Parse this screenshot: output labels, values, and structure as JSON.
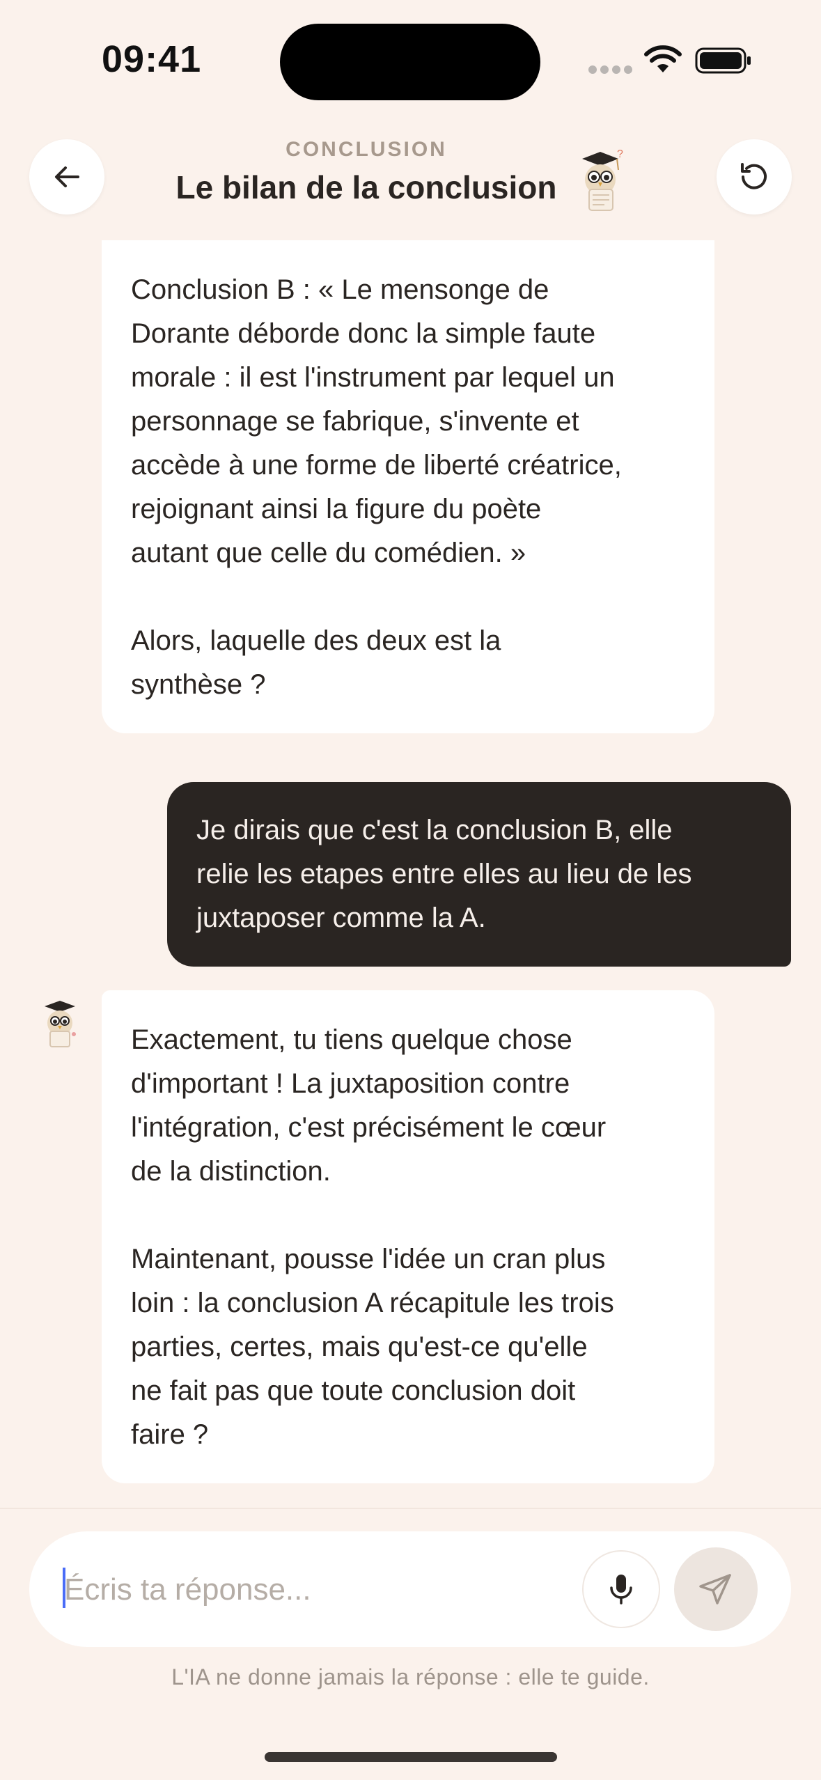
{
  "status_bar": {
    "time": "09:41"
  },
  "header": {
    "eyebrow": "CONCLUSION",
    "title": "Le bilan de la conclusion",
    "back_icon": "arrow-left-icon",
    "reset_icon": "rotate-ccw-icon",
    "mascot_icon": "owl-graduate-icon"
  },
  "messages": [
    {
      "role": "assistant",
      "text": "Conclusion B : « Le mensonge de\nDorante déborde donc la simple faute\nmorale : il est l'instrument par lequel un\npersonnage se fabrique, s'invente et\naccède à une forme de liberté créatrice,\nrejoignant ainsi la figure du poète\nautant que celle du comédien. »\n\nAlors, laquelle des deux est la\nsynthèse ?"
    },
    {
      "role": "user",
      "text": "Je dirais que c'est la conclusion B, elle\nrelie les etapes entre elles au lieu de les\njuxtaposer comme la A."
    },
    {
      "role": "assistant",
      "text": "Exactement, tu tiens quelque chose\nd'important ! La juxtaposition contre\nl'intégration, c'est précisément le cœur\nde la distinction.\n\nMaintenant, pousse l'idée un cran plus\nloin : la conclusion A récapitule les trois\nparties, certes, mais qu'est-ce qu'elle\nne fait pas que toute conclusion doit\nfaire ?"
    }
  ],
  "composer": {
    "placeholder": "Écris ta réponse...",
    "value": "",
    "mic_icon": "microphone-icon",
    "send_icon": "send-icon"
  },
  "footer": {
    "disclaimer": "L'IA ne donne jamais la réponse : elle te guide."
  },
  "colors": {
    "background": "#FBF2EC",
    "user_bubble": "#2A2522",
    "assistant_bubble": "#FFFFFF",
    "muted_text": "#A7998D"
  }
}
